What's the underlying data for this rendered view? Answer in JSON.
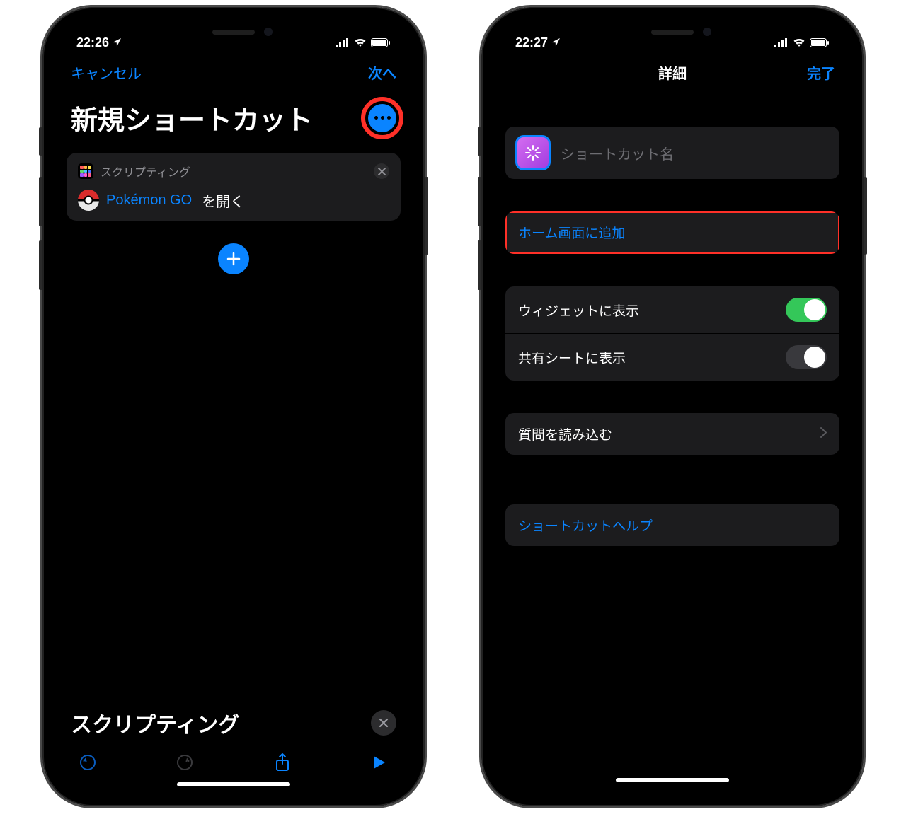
{
  "left": {
    "status": {
      "time": "22:26"
    },
    "nav": {
      "cancel": "キャンセル",
      "next": "次へ"
    },
    "title": "新規ショートカット",
    "card": {
      "category": "スクリプティング",
      "app_name": "Pokémon GO",
      "verb": "を開く"
    },
    "search": "スクリプティング"
  },
  "right": {
    "status": {
      "time": "22:27"
    },
    "nav": {
      "title": "詳細",
      "done": "完了"
    },
    "name_placeholder": "ショートカット名",
    "add_home": "ホーム画面に追加",
    "widget": "ウィジェットに表示",
    "share_sheet": "共有シートに表示",
    "load_questions": "質問を読み込む",
    "help": "ショートカットヘルプ"
  }
}
